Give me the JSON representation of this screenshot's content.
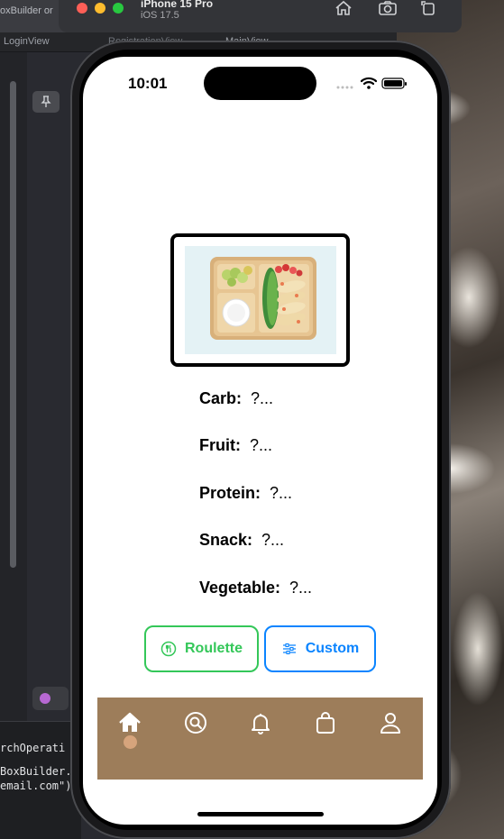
{
  "xcode": {
    "window_title_fragment": "oxBuilder or",
    "tabs": [
      "LoginView",
      "RegistrationView",
      "MainView"
    ],
    "console_lines": [
      "rchOperati",
      "BoxBuilder.",
      "email.com\")"
    ]
  },
  "simulator": {
    "device_name": "iPhone 15 Pro",
    "os_version": "iOS 17.5",
    "toolbar_icons": [
      "home-icon",
      "screenshot-icon",
      "rotate-icon"
    ]
  },
  "status_bar": {
    "time": "10:01"
  },
  "food_image": {
    "description": "bento box tray"
  },
  "food_rows": [
    {
      "label": "Carb:",
      "value": "?..."
    },
    {
      "label": "Fruit:",
      "value": "?..."
    },
    {
      "label": "Protein:",
      "value": "?..."
    },
    {
      "label": "Snack:",
      "value": "?..."
    },
    {
      "label": "Vegetable:",
      "value": "?..."
    }
  ],
  "buttons": {
    "roulette": "Roulette",
    "custom": "Custom"
  },
  "tab_bar": {
    "items": [
      "home-icon",
      "search-icon",
      "bell-icon",
      "bag-icon",
      "profile-icon"
    ],
    "selected": "home-icon",
    "color": "#9d7d5a"
  },
  "colors": {
    "roulette": "#34c759",
    "custom": "#0a84ff"
  }
}
